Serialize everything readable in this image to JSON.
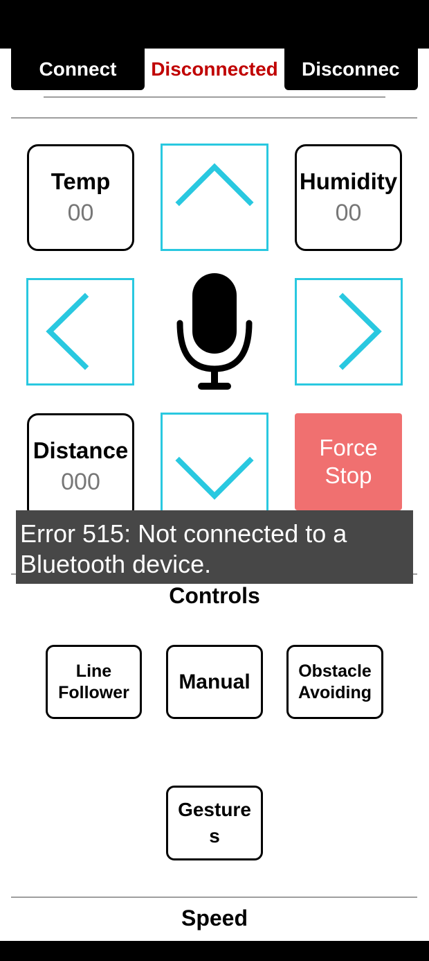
{
  "connection": {
    "connect_label": "Connect",
    "status_label": "Disconnected",
    "disconnect_label": "Disconnec",
    "status_color": "#c00000"
  },
  "sensors": {
    "temp": {
      "label": "Temp",
      "value": "00"
    },
    "humidity": {
      "label": "Humidity",
      "value": "00"
    },
    "distance": {
      "label": "Distance",
      "value": "000"
    }
  },
  "drive": {
    "accent_color": "#29c8e0",
    "icons": [
      "chevron-up-icon",
      "chevron-left-icon",
      "microphone-icon",
      "chevron-right-icon",
      "chevron-down-icon"
    ]
  },
  "force_stop": {
    "line1": "Force",
    "line2": "Stop",
    "color": "#f07070"
  },
  "toast": {
    "line1": "Error 515: Not connected to a",
    "line2": "Bluetooth device."
  },
  "controls": {
    "title": "Controls",
    "modes": {
      "line_follower": {
        "line1": "Line",
        "line2": "Follower"
      },
      "manual": {
        "label": "Manual"
      },
      "obstacle_avoiding": {
        "line1": "Obstacle",
        "line2": "Avoiding"
      },
      "gestures": {
        "line1": "Gesture",
        "line2": "s"
      }
    }
  },
  "speed": {
    "title": "Speed"
  }
}
